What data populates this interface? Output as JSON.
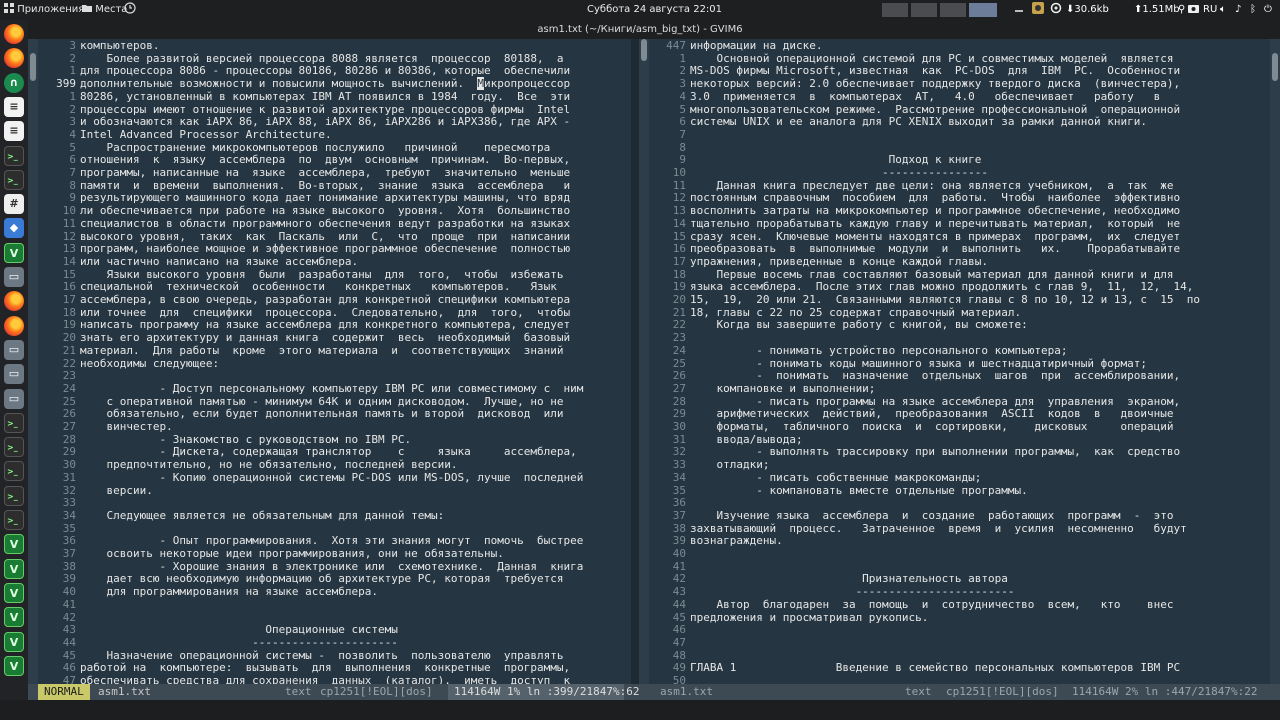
{
  "panel": {
    "applications": "Приложения",
    "places": "Места",
    "clock": "Суббота  24 августа  22:01",
    "net_down": "30.6kb",
    "net_up": "1.51Mb",
    "keyboard_layout": "RU"
  },
  "window": {
    "title": "asm1.txt (~/Книги/asm_big_txt) - GVIM6"
  },
  "dock": {
    "icons": [
      "firefox-icon",
      "firefox-icon",
      "green-app-icon",
      "document-icon",
      "document-icon",
      "terminal-icon",
      "terminal-icon",
      "calculator-icon",
      "store-icon",
      "vim-icon",
      "drive-icon",
      "firefox-icon",
      "firefox-icon",
      "drive-icon",
      "drive-icon",
      "drive-icon",
      "terminal-icon",
      "terminal-icon",
      "terminal-icon",
      "terminal-icon",
      "terminal-icon",
      "vim-icon",
      "vim-icon",
      "vim-icon",
      "vim-icon",
      "vim-icon",
      "vim-icon"
    ]
  },
  "left_pane": {
    "lines": [
      {
        "n": "3",
        "t": "компьютеров."
      },
      {
        "n": "2",
        "t": "    Более развитой версией процессора 8088 является  процессор  80188,  а"
      },
      {
        "n": "1",
        "t": "для процессора 8086 - процессоры 80186, 80286 и 80386, которые  обеспечили"
      },
      {
        "n": "399",
        "t": "дополнительные возможности и повысили мощность вычислений.  Микропроцессор",
        "cur": true
      },
      {
        "n": "1",
        "t": "80286, установленный в компьютерах IBM AT появился в 1984  году.  Все  эти"
      },
      {
        "n": "2",
        "t": "процессоры имеют отношение к развитой архитектуре процессоров фирмы  Intel"
      },
      {
        "n": "3",
        "t": "и обозначаются как iAPX 86, iAPX 88, iAPX 86, iAPX286 и iAPX386, где APX -"
      },
      {
        "n": "4",
        "t": "Intel Advanced Processor Architecture."
      },
      {
        "n": "5",
        "t": "    Распространение микрокомпьютеров послужило   причиной    пересмотра"
      },
      {
        "n": "6",
        "t": "отношения  к  языку  ассемблера  по  двум  основным  причинам.  Во-первых,"
      },
      {
        "n": "7",
        "t": "программы, написанные на  языке  ассемблера,  требуют  значительно  меньше"
      },
      {
        "n": "8",
        "t": "памяти  и  времени  выполнения.  Во-вторых,  знание  языка  ассемблера   и"
      },
      {
        "n": "9",
        "t": "результирующего машинного кода дает понимание архитектуры машины, что вряд"
      },
      {
        "n": "10",
        "t": "ли обеспечивается при работе на языке высокого  уровня.  Хотя  большинство"
      },
      {
        "n": "11",
        "t": "специалистов в области программного обеспечения ведут разработки на языках"
      },
      {
        "n": "12",
        "t": "высокого уровня,  таких  как  Паскаль  или  С,  что  проще  при  написании"
      },
      {
        "n": "13",
        "t": "программ, наиболее мощное и эффективное программное обеспечение  полностью"
      },
      {
        "n": "14",
        "t": "или частично написано на языке ассемблера."
      },
      {
        "n": "15",
        "t": "    Языки высокого уровня  были  разработаны  для  того,  чтобы  избежать"
      },
      {
        "n": "16",
        "t": "специальной  технической  особенности   конкретных   компьютеров.   Язык"
      },
      {
        "n": "17",
        "t": "ассемблера, в свою очередь, разработан для конкретной специфики компьютера"
      },
      {
        "n": "18",
        "t": "или точнее  для  специфики  процессора.  Следовательно,  для  того,  чтобы"
      },
      {
        "n": "19",
        "t": "написать программу на языке ассемблера для конкретного компьютера, следует"
      },
      {
        "n": "20",
        "t": "знать его архитектуру и данная книга  содержит  весь  необходимый  базовый"
      },
      {
        "n": "21",
        "t": "материал.  Для работы  кроме  этого материала  и  соответствующих  знаний"
      },
      {
        "n": "22",
        "t": "необходимы следующее:"
      },
      {
        "n": "23",
        "t": ""
      },
      {
        "n": "24",
        "t": "            - Доступ персональному компьютеру IBM PC или совместимому с  ним"
      },
      {
        "n": "25",
        "t": "    с оперативной памятью - минимум 64К и одним дисководом.  Лучше, но не"
      },
      {
        "n": "26",
        "t": "    обязательно, если будет дополнительная память и второй  дисковод  или"
      },
      {
        "n": "27",
        "t": "    винчестер."
      },
      {
        "n": "28",
        "t": "            - Знакомство с руководством по IBM PC."
      },
      {
        "n": "29",
        "t": "            - Дискета, содержащая транслятор    с     языка     ассемблера,"
      },
      {
        "n": "30",
        "t": "    предпочтительно, но не обязательно, последней версии."
      },
      {
        "n": "31",
        "t": "            - Копию операционной системы PC-DOS или MS-DOS, лучше  последней"
      },
      {
        "n": "32",
        "t": "    версии."
      },
      {
        "n": "33",
        "t": ""
      },
      {
        "n": "34",
        "t": "    Следующее является не обязательным для данной темы:"
      },
      {
        "n": "35",
        "t": ""
      },
      {
        "n": "36",
        "t": "            - Опыт программирования.  Хотя эти знания могут  помочь  быстрее"
      },
      {
        "n": "37",
        "t": "    освоить некоторые идеи программирования, они не обязательны."
      },
      {
        "n": "38",
        "t": "            - Хорошие знания в электронике или  схемотехнике.  Данная  книга"
      },
      {
        "n": "39",
        "t": "    дает всю необходимую информацию об архитектуре PC, которая  требуется"
      },
      {
        "n": "40",
        "t": "    для программирования на языке ассемблера."
      },
      {
        "n": "41",
        "t": ""
      },
      {
        "n": "42",
        "t": ""
      },
      {
        "n": "43",
        "t": "                            Операционные системы"
      },
      {
        "n": "44",
        "t": "                          ----------------------"
      },
      {
        "n": "45",
        "t": "    Назначение операционной системы -  позволить  пользователю  управлять"
      },
      {
        "n": "46",
        "t": "работой на  компьютере:  вызывать  для  выполнения  конкретные  программы,"
      },
      {
        "n": "47",
        "t": "обеспечивать средства для сохранения  данных  (каталог),  иметь  доступ  к"
      }
    ]
  },
  "right_pane": {
    "lines": [
      {
        "n": "447",
        "t": "информации на диске."
      },
      {
        "n": "1",
        "t": "    Основной операционной системой для PC и совместимых моделей  является"
      },
      {
        "n": "2",
        "t": "MS-DOS фирмы Microsoft, известная  как  PC-DOS  для  IBM  PC.  Особенности"
      },
      {
        "n": "3",
        "t": "некоторых версий: 2.0 обеспечивает поддержку твердого диска  (винчестера),"
      },
      {
        "n": "4",
        "t": "3.0  применяется  в  компьютерах  AT,   4.0   обеспечивает   работу   в"
      },
      {
        "n": "5",
        "t": "многопользовательском режиме.  Рассмотрение профессиональной  операционной"
      },
      {
        "n": "6",
        "t": "системы UNIX и ее аналога для PC XENIX выходит за рамки данной книги."
      },
      {
        "n": "7",
        "t": ""
      },
      {
        "n": "8",
        "t": ""
      },
      {
        "n": "9",
        "t": "                              Подход к книге"
      },
      {
        "n": "10",
        "t": "                             ----------------"
      },
      {
        "n": "11",
        "t": "    Данная книга преследует две цели: она является учебником,  а  так  же"
      },
      {
        "n": "12",
        "t": "постоянным справочным  пособием  для  работы.  Чтобы  наиболее  эффективно"
      },
      {
        "n": "13",
        "t": "восполнить затраты на микрокомпьютер и программное обеспечение, необходимо"
      },
      {
        "n": "14",
        "t": "тщательно прорабатывать каждую главу и перечитывать материал,  который  не"
      },
      {
        "n": "15",
        "t": "сразу ясен.  Ключевые моменты находятся в примерах  программ,  их  следует"
      },
      {
        "n": "16",
        "t": "преобразовать  в  выполнимые  модули  и  выполнить   их.    Прорабатывайте"
      },
      {
        "n": "17",
        "t": "упражнения, приведенные в конце каждой главы."
      },
      {
        "n": "18",
        "t": "    Первые восемь глав составляют базовый материал для данной книги и для"
      },
      {
        "n": "19",
        "t": "языка ассемблера.  После этих глав можно продолжить с глав 9,  11,  12,  14,"
      },
      {
        "n": "20",
        "t": "15,  19,  20 или 21.  Связанными являются главы с 8 по 10, 12 и 13, с  15  по"
      },
      {
        "n": "21",
        "t": "18, главы с 22 по 25 содержат справочный материал."
      },
      {
        "n": "22",
        "t": "    Когда вы завершите работу с книгой, вы сможете:"
      },
      {
        "n": "23",
        "t": ""
      },
      {
        "n": "24",
        "t": "          - понимать устройство персонального компьютера;"
      },
      {
        "n": "25",
        "t": "          - понимать коды машинного языка и шестнадцатиричный формат;"
      },
      {
        "n": "26",
        "t": "          -  понимать  назначение  отдельных  шагов  при  ассемблировании,"
      },
      {
        "n": "27",
        "t": "    компановке и выполнении;"
      },
      {
        "n": "28",
        "t": "          - писать программы на языке ассемблера для  управления  экраном,"
      },
      {
        "n": "29",
        "t": "    арифметических  действий,  преобразования  ASCII  кодов  в   двоичные"
      },
      {
        "n": "30",
        "t": "    форматы,  табличного  поиска  и  сортировки,    дисковых     операций"
      },
      {
        "n": "31",
        "t": "    ввода/вывода;"
      },
      {
        "n": "32",
        "t": "          - выполнять трассировку при выполнении программы,  как  средство"
      },
      {
        "n": "33",
        "t": "    отладки;"
      },
      {
        "n": "34",
        "t": "          - писать собственные макрокоманды;"
      },
      {
        "n": "35",
        "t": "          - компановать вместе отдельные программы."
      },
      {
        "n": "36",
        "t": ""
      },
      {
        "n": "37",
        "t": "    Изучение языка  ассемблера  и  создание  работающих  программ  -  это"
      },
      {
        "n": "38",
        "t": "захватывающий  процесс.   Затраченное  время  и  усилия  несомненно   будут"
      },
      {
        "n": "39",
        "t": "вознаграждены."
      },
      {
        "n": "40",
        "t": ""
      },
      {
        "n": "41",
        "t": ""
      },
      {
        "n": "42",
        "t": "                          Признательность автора"
      },
      {
        "n": "43",
        "t": "                         ------------------------"
      },
      {
        "n": "44",
        "t": "    Автор  благодарен  за  помощь  и  сотрудничество  всем,   кто    внес"
      },
      {
        "n": "45",
        "t": "предложения и просматривал рукопись."
      },
      {
        "n": "46",
        "t": ""
      },
      {
        "n": "47",
        "t": ""
      },
      {
        "n": "48",
        "t": ""
      },
      {
        "n": "49",
        "t": "ГЛАВА 1               Введение в семейство персональных компьютеров IBM PC"
      },
      {
        "n": "50",
        "t": "____________________________________________________________________________"
      }
    ]
  },
  "statusline": {
    "mode": "NORMAL",
    "left_file": "asm1.txt",
    "left_ft": "text",
    "left_enc": "cp1251[!EOL][dos]",
    "left_info": "114164W  1%",
    "left_pos": "ln :399/21847",
    "left_col": "%:62",
    "right_file": "asm1.txt",
    "right_ft": "text",
    "right_enc": "cp1251[!EOL][dos]",
    "right_info": "114164W  2%",
    "right_pos": "ln :447/21847",
    "right_col": "%:22"
  }
}
